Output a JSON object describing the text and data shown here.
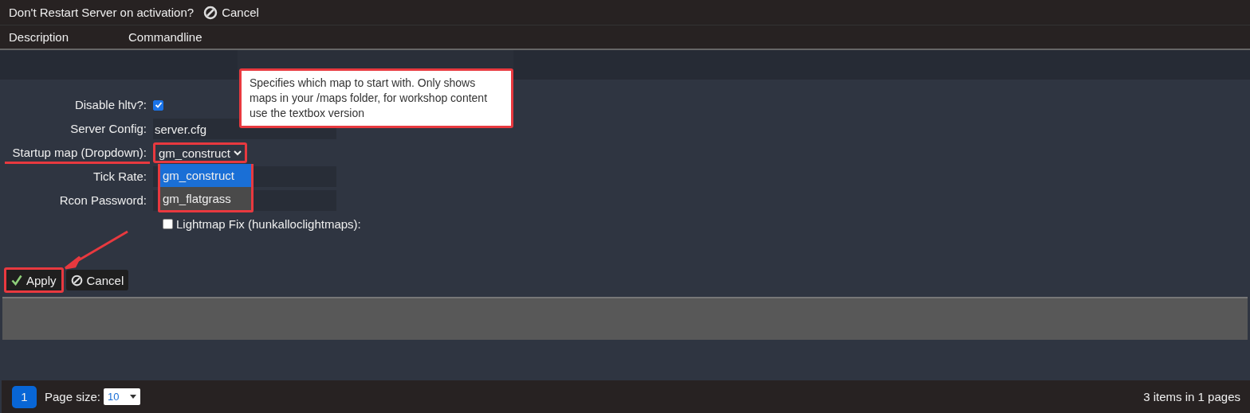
{
  "toolbar": {
    "label": "Don't Restart Server on activation?",
    "cancel": "Cancel"
  },
  "table": {
    "columns": [
      "Description",
      "Commandline"
    ]
  },
  "form": {
    "fields": [
      {
        "kind": "checkbox",
        "label": "Disable hltv?:",
        "checked": true,
        "annotated": false
      },
      {
        "kind": "text",
        "label": "Server Config:",
        "value": "server.cfg",
        "annotated": false
      },
      {
        "kind": "select",
        "label": "Startup map (Dropdown):",
        "value": "gm_construct",
        "annotated": true
      },
      {
        "kind": "text",
        "label": "Tick Rate:",
        "annotated": false
      },
      {
        "kind": "text",
        "label": "Rcon Password:",
        "annotated": false
      }
    ],
    "options": [
      {
        "label": "gm_construct",
        "selected": true
      },
      {
        "label": "gm_flatgrass",
        "selected": false
      }
    ],
    "lightmap": {
      "label": "Lightmap Fix (hunkalloclightmaps):",
      "checked": false
    }
  },
  "tooltip": "Specifies which map to start with. Only shows maps in your /maps folder, for workshop content use the textbox version",
  "buttons": {
    "apply": "Apply",
    "cancel": "Cancel"
  },
  "pager": {
    "page": "1",
    "page_size_label": "Page size:",
    "page_size": "10",
    "summary": "3 items in 1 pages"
  }
}
